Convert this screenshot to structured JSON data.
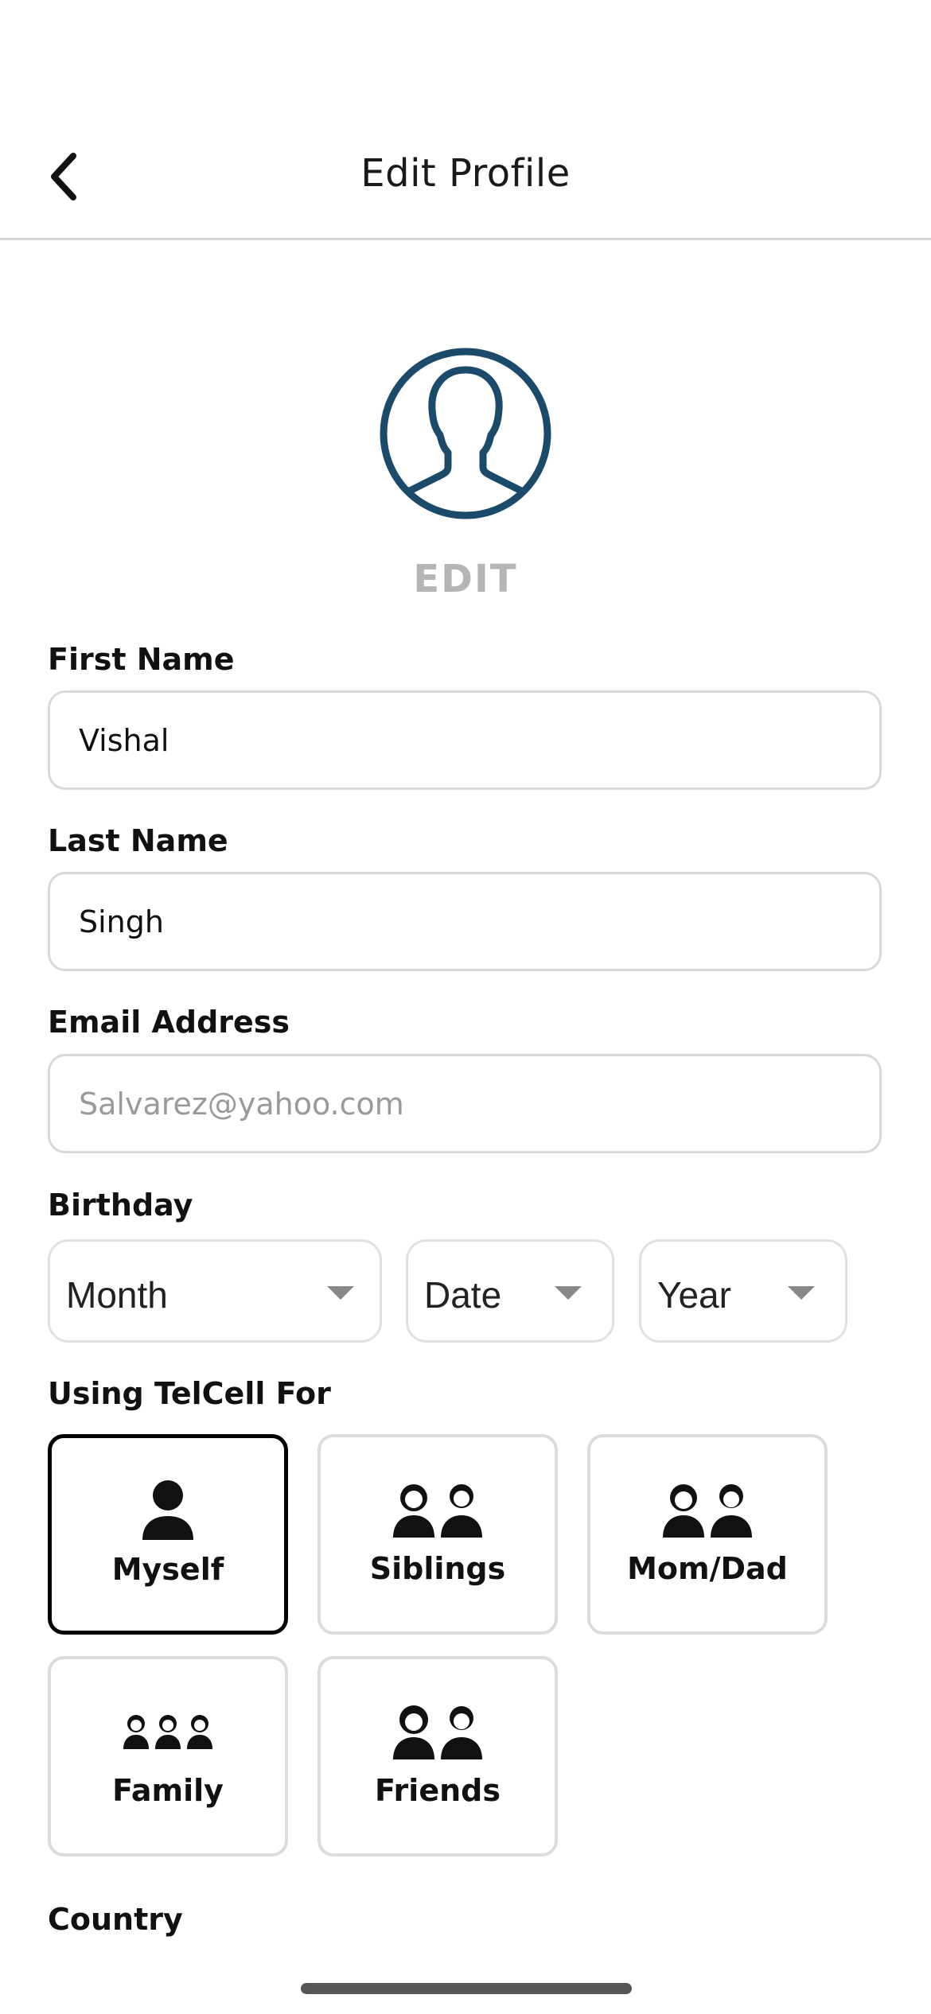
{
  "header": {
    "title": "Edit Profile"
  },
  "avatar": {
    "edit_label": "EDIT"
  },
  "form": {
    "first_name": {
      "label": "First Name",
      "value": "Vishal"
    },
    "last_name": {
      "label": "Last Name",
      "value": "Singh"
    },
    "email": {
      "label": "Email Address",
      "placeholder": "Salvarez@yahoo.com"
    },
    "birthday": {
      "label": "Birthday",
      "month": "Month",
      "date": "Date",
      "year": "Year"
    },
    "usage": {
      "label": "Using TelCell For",
      "options": [
        {
          "label": "Myself",
          "icon": "single-person-icon",
          "selected": true
        },
        {
          "label": "Siblings",
          "icon": "siblings-icon",
          "selected": false
        },
        {
          "label": "Mom/Dad",
          "icon": "parents-icon",
          "selected": false
        },
        {
          "label": "Family",
          "icon": "family-icon",
          "selected": false
        },
        {
          "label": "Friends",
          "icon": "friends-icon",
          "selected": false
        }
      ]
    },
    "country": {
      "label": "Country"
    }
  },
  "colors": {
    "accent": "#1b4a6b",
    "muted": "#b5b5b5",
    "border": "#d9d9d9"
  }
}
